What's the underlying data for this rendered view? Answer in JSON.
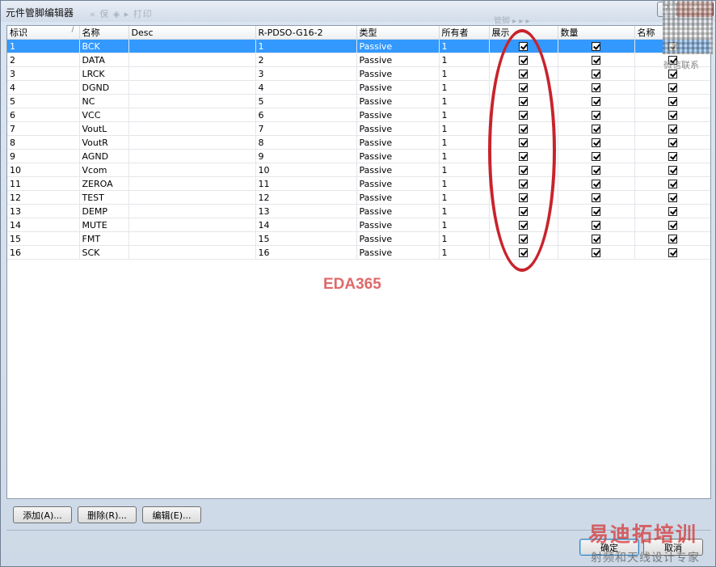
{
  "window": {
    "title": "元件管脚编辑器",
    "title_overlay": "« 保 ◈ ▸ 打印",
    "title_overlay2": "管脚 ▸ ▸ ▸",
    "help_label": "?",
    "close_label": "✕"
  },
  "table": {
    "headers": [
      "标识",
      "名称",
      "Desc",
      "R-PDSO-G16-2",
      "类型",
      "所有者",
      "展示",
      "数量",
      "名称"
    ],
    "sort_indicator": "/",
    "rows": [
      {
        "id": "1",
        "name": "BCK",
        "desc": "",
        "pin": "1",
        "type": "Passive",
        "owner": "1"
      },
      {
        "id": "2",
        "name": "DATA",
        "desc": "",
        "pin": "2",
        "type": "Passive",
        "owner": "1"
      },
      {
        "id": "3",
        "name": "LRCK",
        "desc": "",
        "pin": "3",
        "type": "Passive",
        "owner": "1"
      },
      {
        "id": "4",
        "name": "DGND",
        "desc": "",
        "pin": "4",
        "type": "Passive",
        "owner": "1"
      },
      {
        "id": "5",
        "name": "NC",
        "desc": "",
        "pin": "5",
        "type": "Passive",
        "owner": "1"
      },
      {
        "id": "6",
        "name": "VCC",
        "desc": "",
        "pin": "6",
        "type": "Passive",
        "owner": "1"
      },
      {
        "id": "7",
        "name": "VoutL",
        "desc": "",
        "pin": "7",
        "type": "Passive",
        "owner": "1"
      },
      {
        "id": "8",
        "name": "VoutR",
        "desc": "",
        "pin": "8",
        "type": "Passive",
        "owner": "1"
      },
      {
        "id": "9",
        "name": "AGND",
        "desc": "",
        "pin": "9",
        "type": "Passive",
        "owner": "1"
      },
      {
        "id": "10",
        "name": "Vcom",
        "desc": "",
        "pin": "10",
        "type": "Passive",
        "owner": "1"
      },
      {
        "id": "11",
        "name": "ZEROA",
        "desc": "",
        "pin": "11",
        "type": "Passive",
        "owner": "1"
      },
      {
        "id": "12",
        "name": "TEST",
        "desc": "",
        "pin": "12",
        "type": "Passive",
        "owner": "1"
      },
      {
        "id": "13",
        "name": "DEMP",
        "desc": "",
        "pin": "13",
        "type": "Passive",
        "owner": "1"
      },
      {
        "id": "14",
        "name": "MUTE",
        "desc": "",
        "pin": "14",
        "type": "Passive",
        "owner": "1"
      },
      {
        "id": "15",
        "name": "FMT",
        "desc": "",
        "pin": "15",
        "type": "Passive",
        "owner": "1"
      },
      {
        "id": "16",
        "name": "SCK",
        "desc": "",
        "pin": "16",
        "type": "Passive",
        "owner": "1"
      }
    ],
    "selected_row": 0,
    "checkbox_columns_checked": true
  },
  "buttons": {
    "add": "添加(A)...",
    "remove": "删除(R)...",
    "edit": "编辑(E)...",
    "ok": "确定",
    "cancel": "取消"
  },
  "watermarks": {
    "center": "EDA365",
    "qr_caption": "微信联系",
    "brand": "易迪拓培训",
    "brand_sub": "射频和天线设计专家"
  },
  "colors": {
    "selection": "#3399ff",
    "annotation_ellipse": "#c8232c",
    "center_watermark": "#e06969"
  }
}
